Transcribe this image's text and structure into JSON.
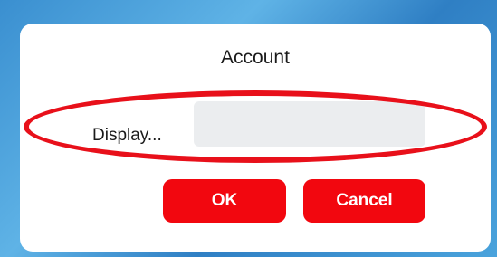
{
  "dialog": {
    "title": "Account",
    "field_label": "Display...",
    "field_value": "",
    "ok_label": "OK",
    "cancel_label": "Cancel"
  },
  "colors": {
    "button": "#f2070f",
    "highlight": "#e8101a",
    "input_bg": "#ebedef"
  }
}
